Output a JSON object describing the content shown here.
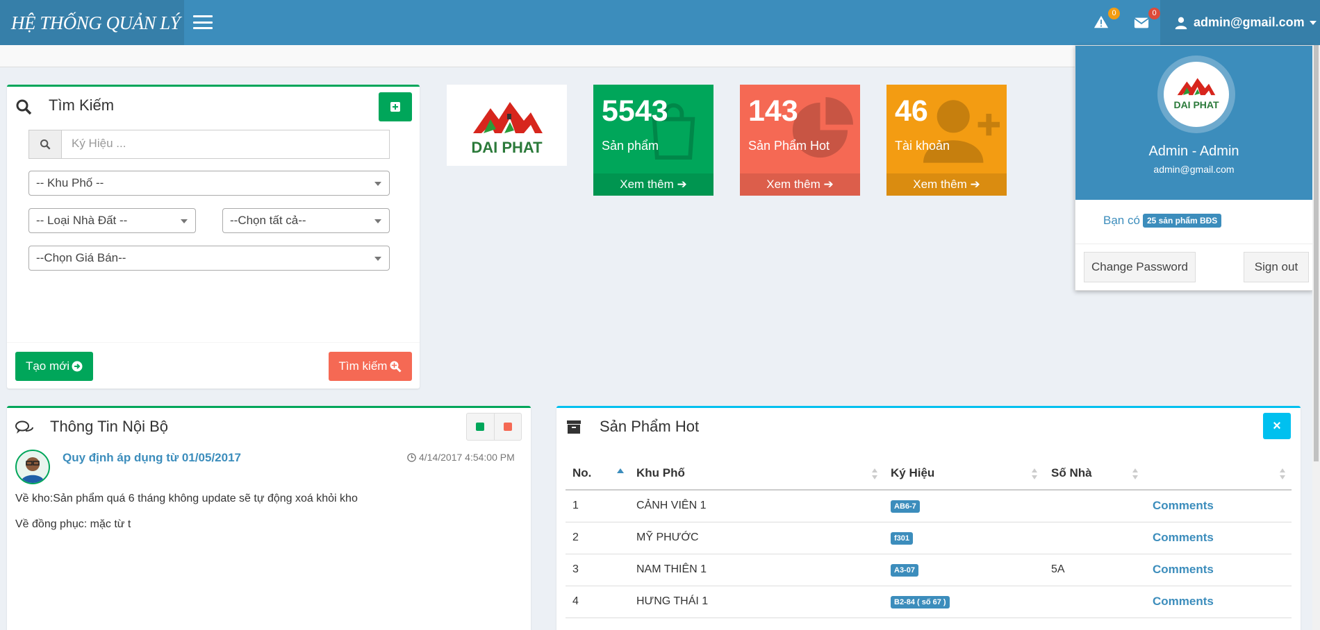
{
  "app": {
    "title": "HỆ THỐNG QUẢN LÝ"
  },
  "header": {
    "alerts_count": "0",
    "messages_count": "0",
    "user_email": "admin@gmail.com"
  },
  "search_box": {
    "title": "Tìm Kiếm",
    "keyword_placeholder": "Ký Hiệu ...",
    "district_select": "-- Khu Phố --",
    "type_select": "-- Loại Nhà Đất --",
    "all_select": "--Chọn tất cả--",
    "price_select": "--Chọn Giá Bán--",
    "create_label": "Tạo mới",
    "search_label": "Tìm kiếm"
  },
  "brand": {
    "logo_text": "DAI PHAT"
  },
  "stats": [
    {
      "value": "5543",
      "label": "Sản phẩm",
      "more": "Xem thêm",
      "color": "#00a65a"
    },
    {
      "value": "143",
      "label": "Sản Phẩm Hot",
      "more": "Xem thêm",
      "color": "#f56954"
    },
    {
      "value": "46",
      "label": "Tài khoản",
      "more": "Xem thêm",
      "color": "#f39c12"
    }
  ],
  "internal_news": {
    "title": "Thông Tin Nội Bộ",
    "post_title": "Quy định áp dụng từ 01/05/2017",
    "post_time": "4/14/2017 4:54:00 PM",
    "lines": [
      "Về kho:Sản phẩm quá 6 tháng không update sẽ tự động xoá khỏi kho",
      "Về đồng phục: mặc từ t"
    ]
  },
  "hot_products": {
    "title": "Sản Phẩm Hot",
    "columns": [
      "No.",
      "Khu Phố",
      "Ký Hiệu",
      "Số Nhà"
    ],
    "rows": [
      {
        "no": "1",
        "district": "CẢNH VIÊN 1",
        "code": "AB6-7",
        "house": "",
        "action": "Comments"
      },
      {
        "no": "2",
        "district": "MỸ PHƯỚC",
        "code": "f301",
        "house": "",
        "action": "Comments"
      },
      {
        "no": "3",
        "district": "NAM THIÊN 1",
        "code": "A3-07",
        "house": "5A",
        "action": "Comments"
      },
      {
        "no": "4",
        "district": "HƯNG THÁI 1",
        "code": "B2-84 ( số 67 )",
        "house": "",
        "action": "Comments"
      }
    ]
  },
  "user_dropdown": {
    "name": "Admin - Admin",
    "email": "admin@gmail.com",
    "info_prefix": "Bạn có",
    "info_badge": "25 sản phẩm BĐS",
    "change_password": "Change Password",
    "sign_out": "Sign out"
  },
  "colors": {
    "primary": "#3c8dbc",
    "primary_dark": "#367fa9",
    "success": "#00a65a",
    "danger": "#f56954",
    "warning": "#f39c12",
    "info": "#00c0ef"
  }
}
